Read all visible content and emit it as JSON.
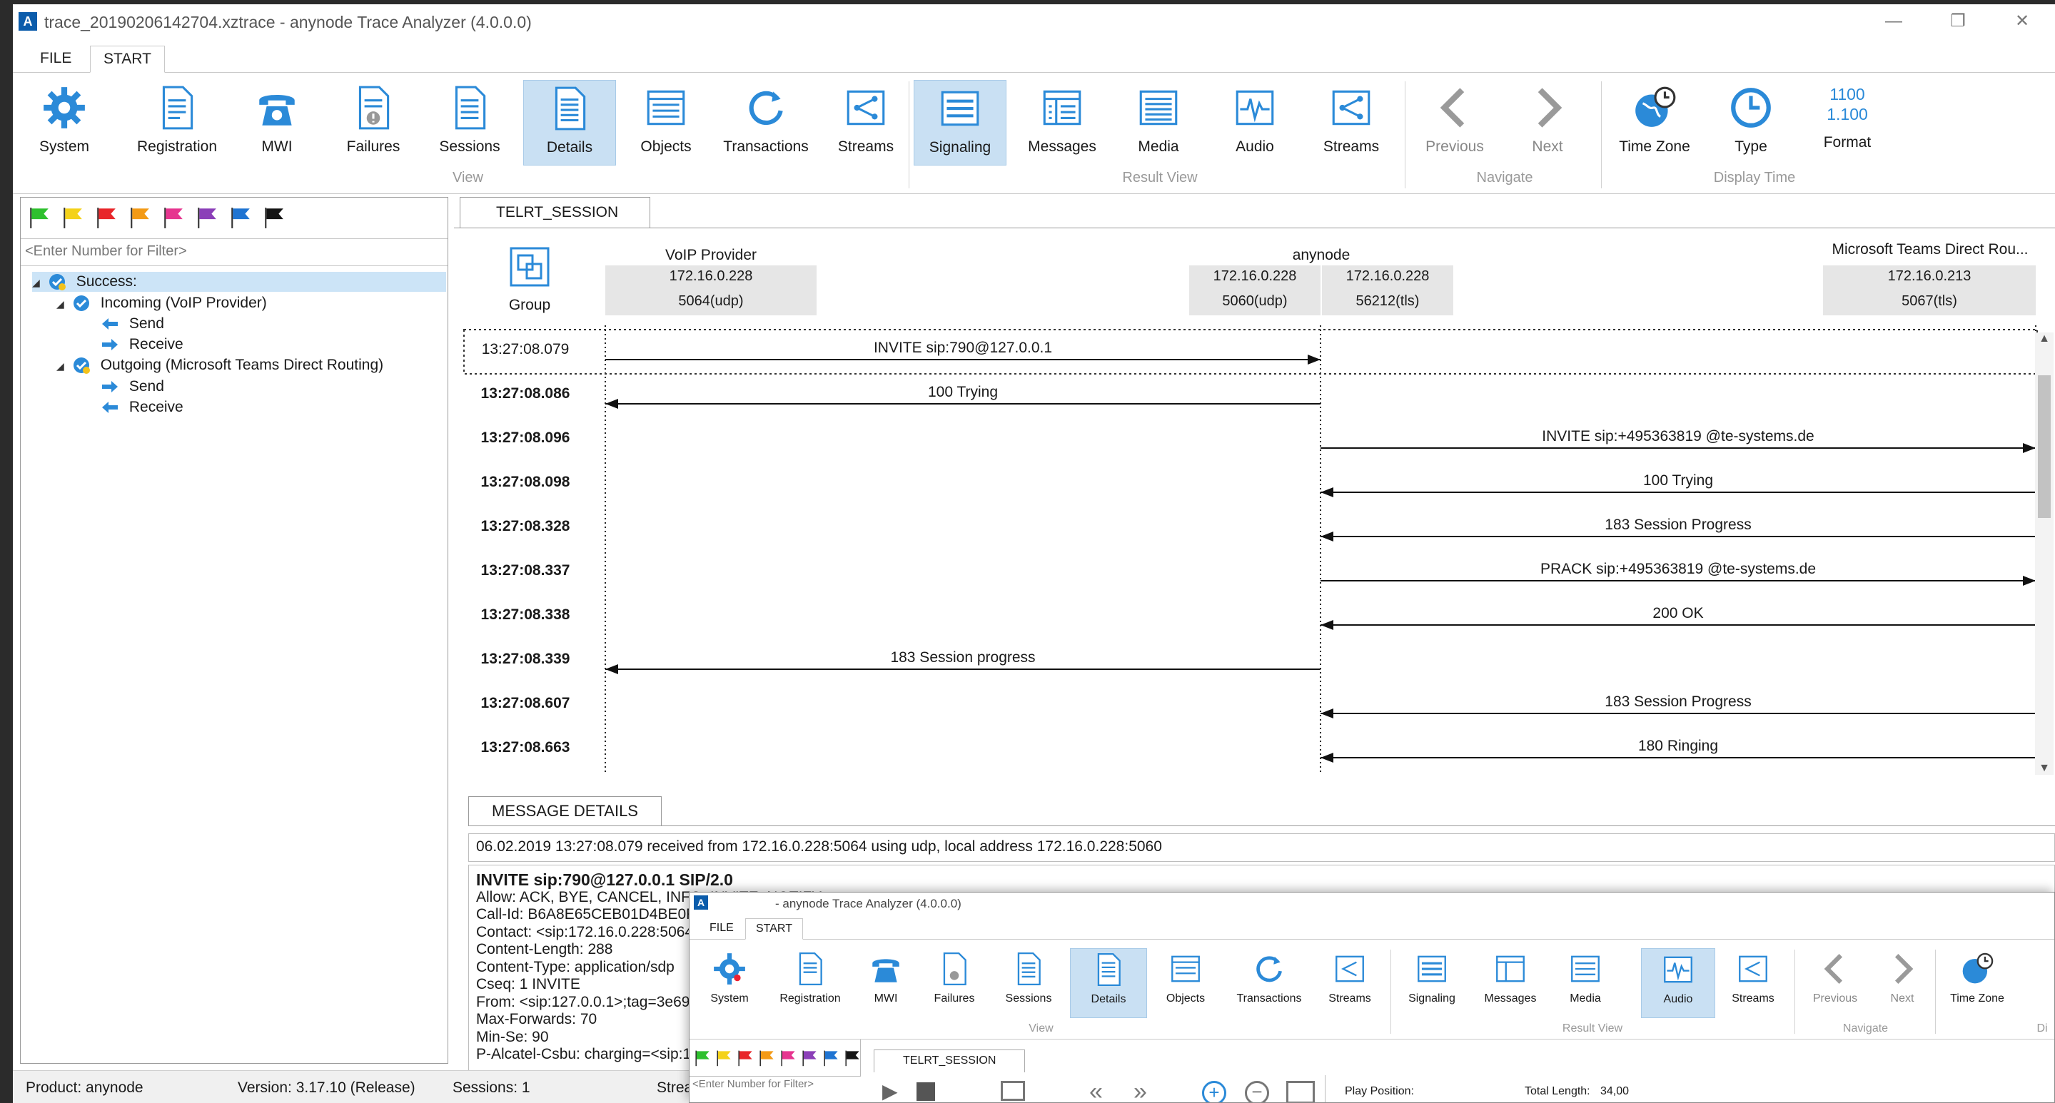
{
  "window": {
    "title": "trace_20190206142704.xztrace - anynode Trace Analyzer (4.0.0.0)",
    "minimize": "—",
    "restore": "❐",
    "close": "✕"
  },
  "menu": {
    "file": "FILE",
    "start": "START"
  },
  "ribbon": {
    "buttons": {
      "system": "System",
      "registration": "Registration",
      "mwi": "MWI",
      "failures": "Failures",
      "sessions": "Sessions",
      "details": "Details",
      "objects": "Objects",
      "transactions": "Transactions",
      "streams": "Streams",
      "signaling": "Signaling",
      "messages": "Messages",
      "media": "Media",
      "audio": "Audio",
      "streams2": "Streams",
      "previous": "Previous",
      "next": "Next",
      "timezone": "Time Zone",
      "type": "Type",
      "format": "Format",
      "format_icon_line1": "1100",
      "format_icon_line2": "1.100"
    },
    "groups": {
      "view": "View",
      "result_view": "Result View",
      "navigate": "Navigate",
      "display_time": "Display Time"
    }
  },
  "left": {
    "flag_colors": [
      "#2ec02e",
      "#f4d21a",
      "#e8262a",
      "#f39a16",
      "#e6358f",
      "#8b3fb8",
      "#1f74d2",
      "#151515"
    ],
    "filter_placeholder": "<Enter Number for Filter>",
    "tree": {
      "success": "Success:",
      "incoming": "Incoming (VoIP Provider)",
      "incoming_send": "Send",
      "incoming_receive": "Receive",
      "outgoing": "Outgoing (Microsoft Teams Direct Routing)",
      "outgoing_send": "Send",
      "outgoing_receive": "Receive"
    }
  },
  "signaling": {
    "tab": "TELRT_SESSION",
    "group_label": "Group",
    "endpoints": {
      "voip_name": "VoIP Provider",
      "voip_ip": "172.16.0.228",
      "voip_port": "5064(udp)",
      "anynode_name": "anynode",
      "anynode_left_ip": "172.16.0.228",
      "anynode_left_port": "5060(udp)",
      "anynode_right_ip": "172.16.0.228",
      "anynode_right_port": "56212(tls)",
      "teams_name": "Microsoft Teams Direct Rou...",
      "teams_ip": "172.16.0.213",
      "teams_port": "5067(tls)"
    },
    "messages": [
      {
        "time": "13:27:08.079",
        "label": "INVITE sip:790@127.0.0.1"
      },
      {
        "time": "13:27:08.086",
        "label": "100 Trying"
      },
      {
        "time": "13:27:08.096",
        "label": "INVITE sip:+495363819      @te-systems.de"
      },
      {
        "time": "13:27:08.098",
        "label": "100 Trying"
      },
      {
        "time": "13:27:08.328",
        "label": "183 Session Progress"
      },
      {
        "time": "13:27:08.337",
        "label": "PRACK sip:+495363819      @te-systems.de"
      },
      {
        "time": "13:27:08.338",
        "label": "200 OK"
      },
      {
        "time": "13:27:08.339",
        "label": "183 Session progress"
      },
      {
        "time": "13:27:08.607",
        "label": "183 Session Progress"
      },
      {
        "time": "13:27:08.663",
        "label": "180 Ringing"
      }
    ]
  },
  "details": {
    "tab": "MESSAGE DETAILS",
    "info": "06.02.2019 13:27:08.079 received from 172.16.0.228:5064 using udp, local address 172.16.0.228:5060",
    "lines": [
      "INVITE sip:790@127.0.0.1 SIP/2.0",
      "Allow: ACK, BYE, CANCEL, INFO, INVITE, NOTIFY",
      "Call-Id: B6A8E65CEB01D4BE0F92C",
      "Contact: <sip:172.16.0.228:5064>",
      "Content-Length: 288",
      "Content-Type: application/sdp",
      "Cseq: 1 INVITE",
      "From: <sip:127.0.0.1>;tag=3e694c0",
      "Max-Forwards: 70",
      "Min-Se: 90",
      "P-Alcatel-Csbu: charging=<sip:127.0"
    ]
  },
  "status": {
    "product": "Product: anynode",
    "version": "Version: 3.17.10 (Release)",
    "sessions": "Sessions: 1",
    "streams": "Strea"
  },
  "overlay": {
    "title": "- anynode Trace Analyzer (4.0.0.0)",
    "file": "FILE",
    "start": "START",
    "buttons": {
      "system": "System",
      "registration": "Registration",
      "mwi": "MWI",
      "failures": "Failures",
      "sessions": "Sessions",
      "details": "Details",
      "objects": "Objects",
      "transactions": "Transactions",
      "streams": "Streams",
      "signaling": "Signaling",
      "messages": "Messages",
      "media": "Media",
      "audio": "Audio",
      "streams2": "Streams",
      "previous": "Previous",
      "next": "Next",
      "timezone": "Time Zone"
    },
    "groups": {
      "view": "View",
      "result_view": "Result View",
      "navigate": "Navigate",
      "cut": "Di"
    },
    "tab": "TELRT_SESSION",
    "filter_placeholder": "<Enter Number for Filter>",
    "play_position_label": "Play Position:",
    "total_length_label": "Total Length:",
    "total_length_value": "34,00"
  }
}
